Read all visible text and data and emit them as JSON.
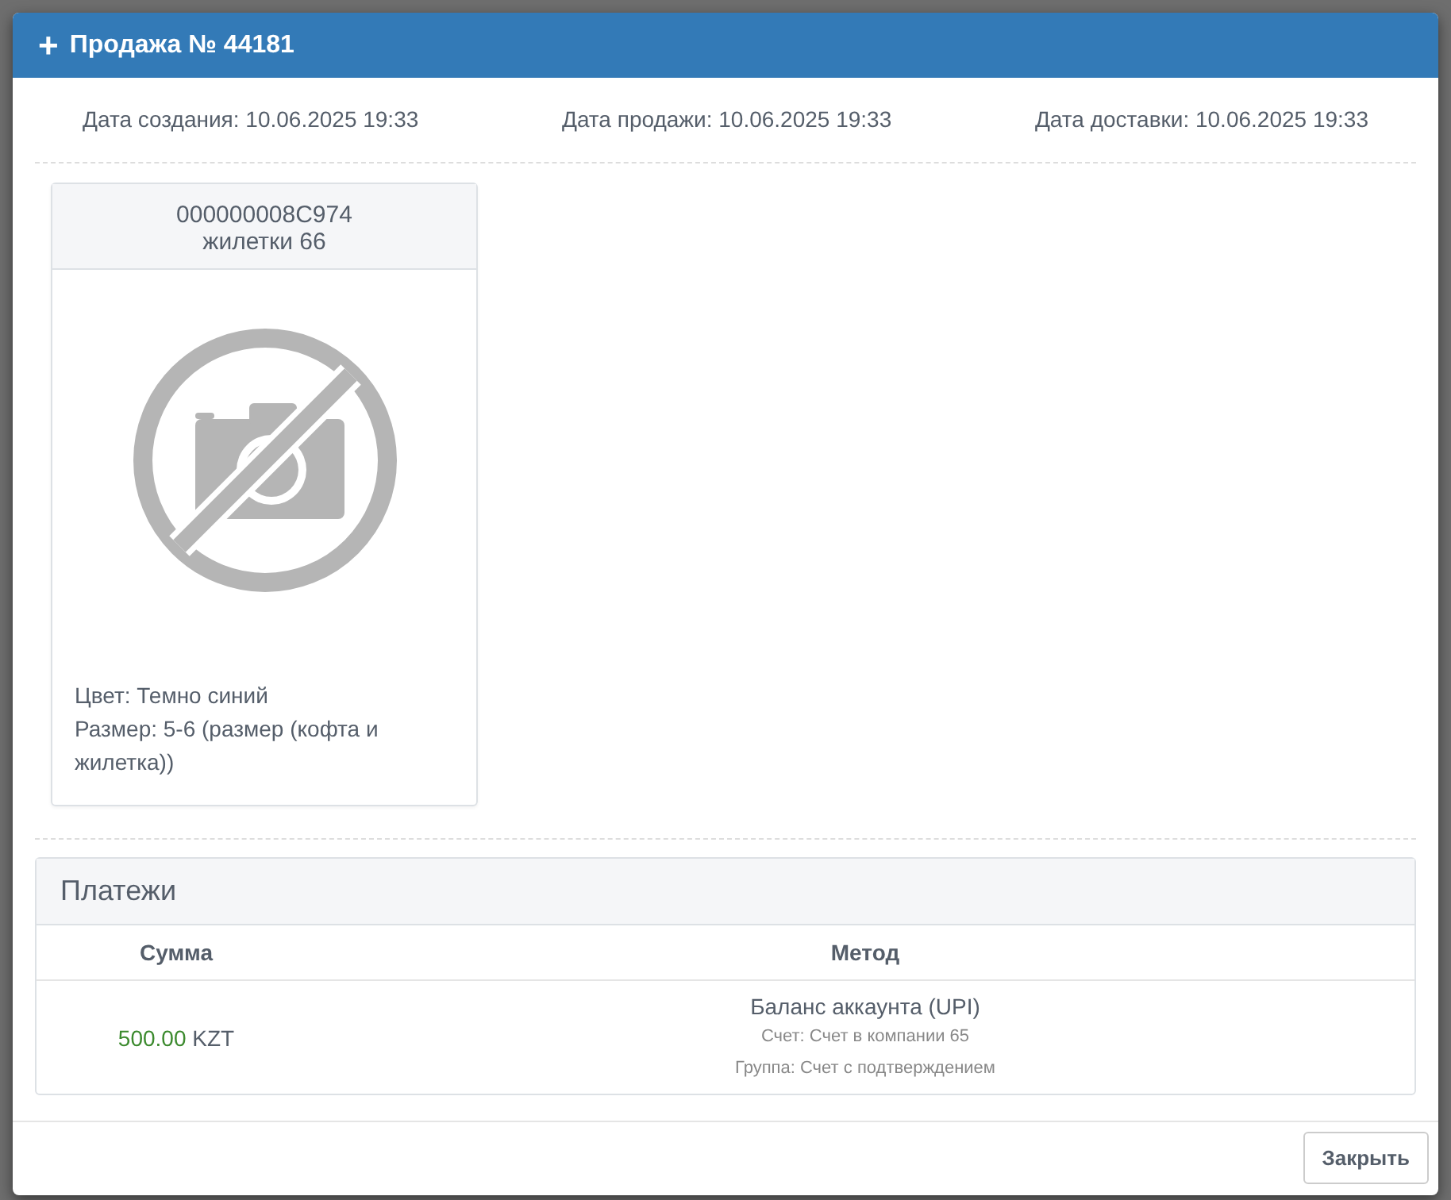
{
  "modal": {
    "title": "Продажа № 44181",
    "icon": "+"
  },
  "dates": [
    "Дата создания: 10.06.2025 19:33",
    "Дата продажи: 10.06.2025 19:33",
    "Дата доставки: 10.06.2025 19:33"
  ],
  "products": [
    {
      "code": "000000008C974",
      "name": "жилетки 66",
      "attributes": [
        "Цвет: Темно синий",
        "Размер: 5-6 (размер (кофта и жилетка))"
      ]
    }
  ],
  "payments": {
    "title": "Платежи",
    "columns": [
      "Сумма",
      "Метод"
    ],
    "rows": [
      {
        "amount": "500.00",
        "currency": "KZT",
        "method": "Баланс аккаунта (UPI)",
        "details": [
          "Счет: Счет в компании 65",
          "Группа: Счет с подтверждением"
        ]
      }
    ]
  },
  "buttons": [
    "Закрыть"
  ]
}
